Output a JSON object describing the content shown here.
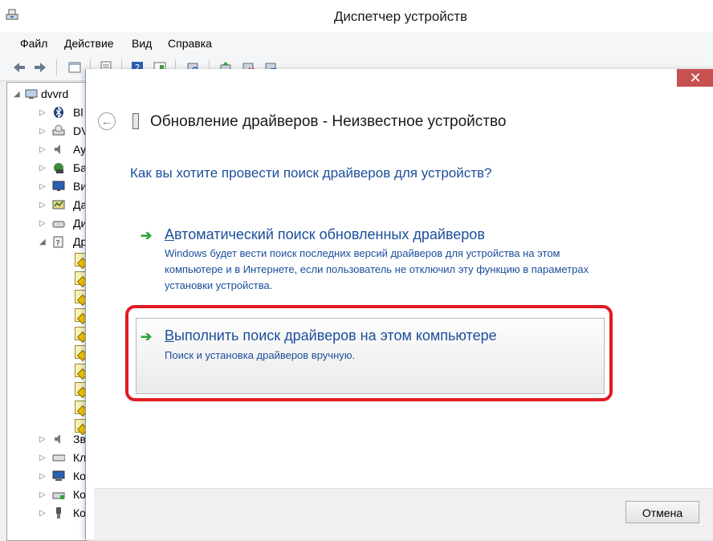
{
  "window": {
    "title": "Диспетчер устройств"
  },
  "menu": [
    "Файл",
    "Действие",
    "Вид",
    "Справка"
  ],
  "tree": {
    "root_label": "dvvrd",
    "top_items": [
      "Bl",
      "DV",
      "Ау",
      "Ба",
      "Ви",
      "Да",
      "Ди",
      "Др"
    ],
    "bottom_items": [
      "Зв",
      "Кл",
      "Ко",
      "Ко",
      "Ко"
    ]
  },
  "dialog": {
    "close_glyph": "✕",
    "title": "Обновление драйверов - Неизвестное устройство",
    "question": "Как вы хотите провести поиск драйверов для устройств?",
    "option_auto": {
      "title_first_letter": "А",
      "title_rest": "втоматический поиск обновленных драйверов",
      "description": "Windows будет вести поиск последних версий драйверов для устройства на этом компьютере и в Интернете, если пользователь не отключил эту функцию в параметрах установки устройства."
    },
    "option_manual": {
      "title_first_letter": "В",
      "title_rest": "ыполнить поиск драйверов на этом компьютере",
      "description": "Поиск и установка драйверов вручную."
    },
    "cancel_label": "Отмена"
  },
  "colors": {
    "link_blue": "#1b4e9b",
    "close_red": "#c75050",
    "highlight_red": "#e01b24",
    "arrow_green": "#2fa63a"
  }
}
